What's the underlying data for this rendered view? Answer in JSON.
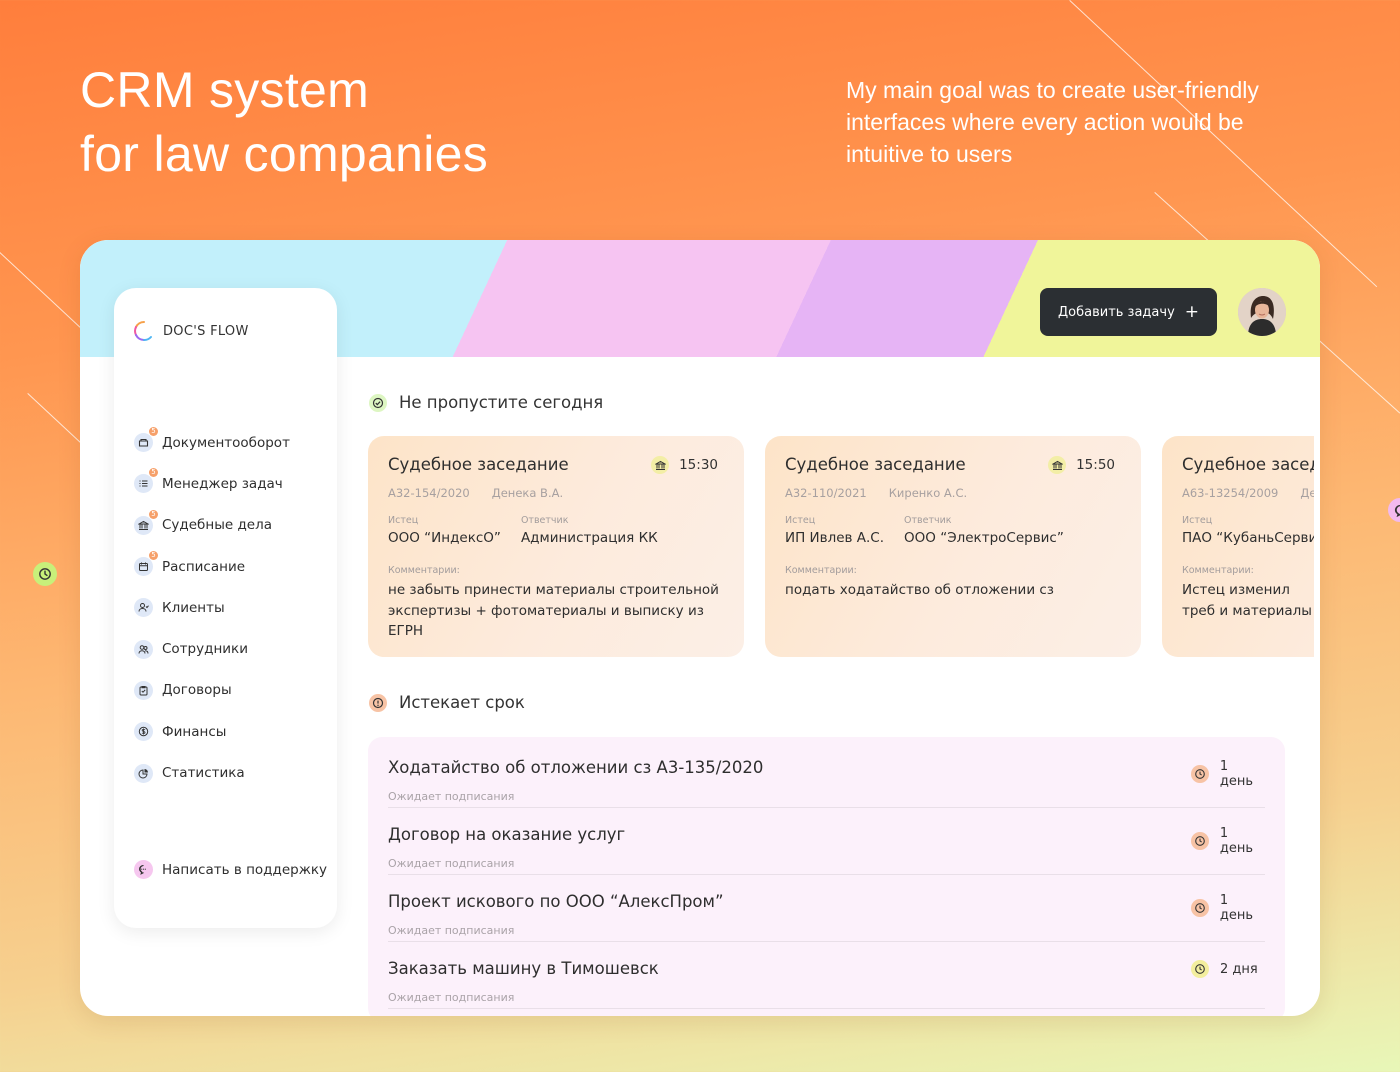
{
  "hero": {
    "title_line1": "CRM system",
    "title_line2": "for law companies",
    "subtitle": "My main goal was to create user-friendly interfaces where every action would be intuitive to users"
  },
  "brand": {
    "name": "DOC'S FLOW"
  },
  "header": {
    "add_task_label": "Добавить задачу",
    "add_task_icon": "+"
  },
  "sidebar": {
    "items": [
      {
        "label": "Документооборот",
        "icon": "folder-icon",
        "badge": "5"
      },
      {
        "label": "Менеджер задач",
        "icon": "task-list-icon",
        "badge": "5"
      },
      {
        "label": "Судебные дела",
        "icon": "courthouse-icon",
        "badge": "5"
      },
      {
        "label": "Расписание",
        "icon": "calendar-icon",
        "badge": "5"
      },
      {
        "label": "Клиенты",
        "icon": "user-icon",
        "badge": ""
      },
      {
        "label": "Сотрудники",
        "icon": "users-icon",
        "badge": ""
      },
      {
        "label": "Договоры",
        "icon": "clipboard-icon",
        "badge": ""
      },
      {
        "label": "Финансы",
        "icon": "dollar-icon",
        "badge": ""
      },
      {
        "label": "Статистика",
        "icon": "pie-chart-icon",
        "badge": ""
      }
    ],
    "support_label": "Написать в поддержку"
  },
  "today": {
    "title": "Не пропустите сегодня",
    "cards": [
      {
        "title": "Судебное заседание",
        "time": "15:30",
        "case_no": "А32-154/2020",
        "judge": "Денека В.А.",
        "plaintiff_label": "Истец",
        "plaintiff": "ООО “ИндексО”",
        "defendant_label": "Ответчик",
        "defendant": "Администрация КК",
        "comment_label": "Комментарии:",
        "comment": "не забыть принести материалы строительной экспертизы + фотоматериалы и выписку из ЕГРН"
      },
      {
        "title": "Судебное заседание",
        "time": "15:50",
        "case_no": "А32-110/2021",
        "judge": "Киренко А.С.",
        "plaintiff_label": "Истец",
        "plaintiff": "ИП Ивлев А.С.",
        "defendant_label": "Ответчик",
        "defendant": "ООО “ЭлектроСервис”",
        "comment_label": "Комментарии:",
        "comment": "подать ходатайство об отложении сз"
      },
      {
        "title": "Судебное заседание",
        "time": "",
        "case_no": "А63-13254/2009",
        "judge": "Де",
        "plaintiff_label": "Истец",
        "plaintiff": "ПАО “КубаньСервис",
        "defendant_label": "",
        "defendant": "",
        "comment_label": "Комментарии:",
        "comment": "Истец изменил треб и материалы"
      }
    ]
  },
  "deadlines": {
    "title": "Истекает срок",
    "items": [
      {
        "title": "Ходатайство об отложении сз  А3-135/2020",
        "status": "Ожидает подписания",
        "time": "1 день",
        "color": "#f7c3a5"
      },
      {
        "title": "Договор на оказание услуг",
        "status": "Ожидает подписания",
        "time": "1 день",
        "color": "#f7c3a5"
      },
      {
        "title": "Проект искового по ООО “АлексПром”",
        "status": "Ожидает подписания",
        "time": "1 день",
        "color": "#f7c3a5"
      },
      {
        "title": "Заказать машину в Тимошевск",
        "status": "Ожидает подписания",
        "time": "2 дня",
        "color": "#f3ee9e"
      }
    ]
  },
  "colors": {
    "accent_dark": "#2b2f33",
    "card_bg": "#fde4c8",
    "deadlines_bg": "#fcf1fb",
    "header_blue": "#c2f0fb",
    "header_pink": "#f6c4f2",
    "header_violet": "#e6b4f5",
    "header_yellow": "#f0f59a"
  }
}
